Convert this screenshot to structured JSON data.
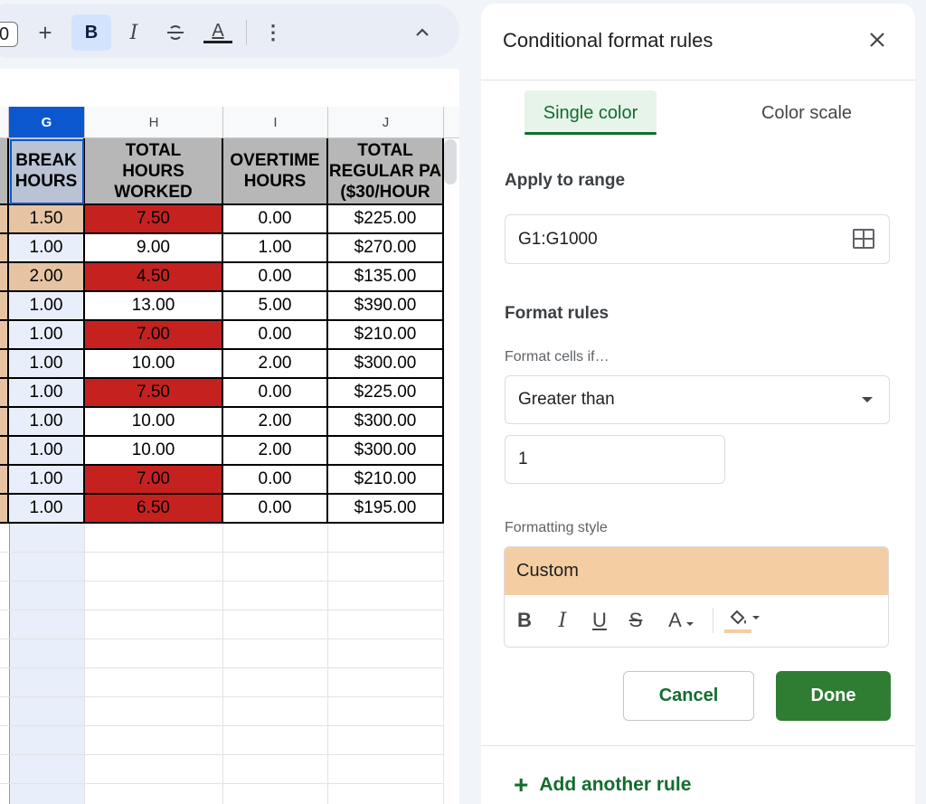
{
  "toolbar": {
    "zoom_value": "0",
    "plus_label": "+",
    "bold_label": "B",
    "italic_label": "I",
    "strike_label": "S",
    "text_color_label": "A",
    "more_label": "⋮",
    "collapse_label": "^"
  },
  "grid": {
    "columns": [
      "G",
      "H",
      "I",
      "J"
    ],
    "selected_column": "G",
    "headers": {
      "g": [
        "BREAK",
        "HOURS"
      ],
      "h": [
        "TOTAL",
        "HOURS",
        "WORKED"
      ],
      "i": [
        "OVERTIME",
        "HOURS"
      ],
      "j": [
        "TOTAL",
        "REGULAR PA",
        "($30/HOUR"
      ]
    },
    "rows": [
      {
        "g": "1.50",
        "h": "7.50",
        "i": "0.00",
        "j": "$225.00"
      },
      {
        "g": "1.00",
        "h": "9.00",
        "i": "1.00",
        "j": "$270.00"
      },
      {
        "g": "2.00",
        "h": "4.50",
        "i": "0.00",
        "j": "$135.00"
      },
      {
        "g": "1.00",
        "h": "13.00",
        "i": "5.00",
        "j": "$390.00"
      },
      {
        "g": "1.00",
        "h": "7.00",
        "i": "0.00",
        "j": "$210.00"
      },
      {
        "g": "1.00",
        "h": "10.00",
        "i": "2.00",
        "j": "$300.00"
      },
      {
        "g": "1.00",
        "h": "7.50",
        "i": "0.00",
        "j": "$225.00"
      },
      {
        "g": "1.00",
        "h": "10.00",
        "i": "2.00",
        "j": "$300.00"
      },
      {
        "g": "1.00",
        "h": "10.00",
        "i": "2.00",
        "j": "$300.00"
      },
      {
        "g": "1.00",
        "h": "7.00",
        "i": "0.00",
        "j": "$210.00"
      },
      {
        "g": "1.00",
        "h": "6.50",
        "i": "0.00",
        "j": "$195.00"
      }
    ],
    "colors": {
      "red_fill": "#c5221f",
      "tan_fill": "#e6c4a2",
      "header_fill": "#b7b7b7",
      "selection": "#0b57d0"
    }
  },
  "panel": {
    "title": "Conditional format rules",
    "close_icon": "close-icon",
    "tabs": [
      {
        "label": "Single color",
        "active": true
      },
      {
        "label": "Color scale",
        "active": false
      }
    ],
    "apply_to_range_label": "Apply to range",
    "range_value": "G1:G1000",
    "format_rules_label": "Format rules",
    "format_cells_if_label": "Format cells if…",
    "condition_value": "Greater than",
    "condition_input_value": "1",
    "formatting_style_label": "Formatting style",
    "style_preview_label": "Custom",
    "style_preview_color": "#f4cda2",
    "style_tools": {
      "bold": "B",
      "italic": "I",
      "underline": "U",
      "strike": "S",
      "text_color": "A",
      "fill_icon": "fill-color-icon"
    },
    "cancel_label": "Cancel",
    "done_label": "Done",
    "add_rule_label": "Add another rule",
    "accent_color": "#146c2e",
    "done_color": "#2e7d32"
  }
}
